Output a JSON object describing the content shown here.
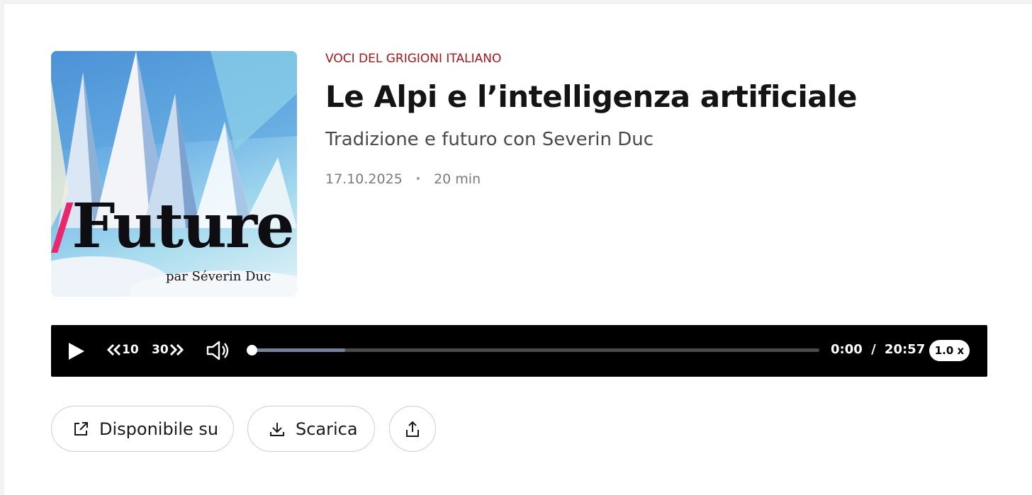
{
  "cover": {
    "slash": "/",
    "title": "Future",
    "subtitle": "par Séverin Duc",
    "accent_color": "#e8286d"
  },
  "episode": {
    "program": "VOCI DEL GRIGIONI ITALIANO",
    "title": "Le Alpi e l’intelligenza artificiale",
    "subtitle": "Tradizione e futuro con Severin Duc",
    "date": "17.10.2025",
    "separator": "•",
    "duration": "20 min"
  },
  "player": {
    "play_icon": "play-icon",
    "skip_back_label": "10",
    "skip_forward_label": "30",
    "volume_icon": "volume-icon",
    "current_time": "0:00",
    "time_separator": "/",
    "total_time": "20:57",
    "progress": 0,
    "buffered": 0.165,
    "speed": "1.0 x"
  },
  "actions": {
    "available_label": "Disponibile su",
    "available_icon": "external-link-icon",
    "download_label": "Scarica",
    "download_icon": "download-icon",
    "share_icon": "share-icon"
  },
  "colors": {
    "program": "#a3161c",
    "player_bg": "#000000",
    "progress_buffer": "#75839a"
  }
}
